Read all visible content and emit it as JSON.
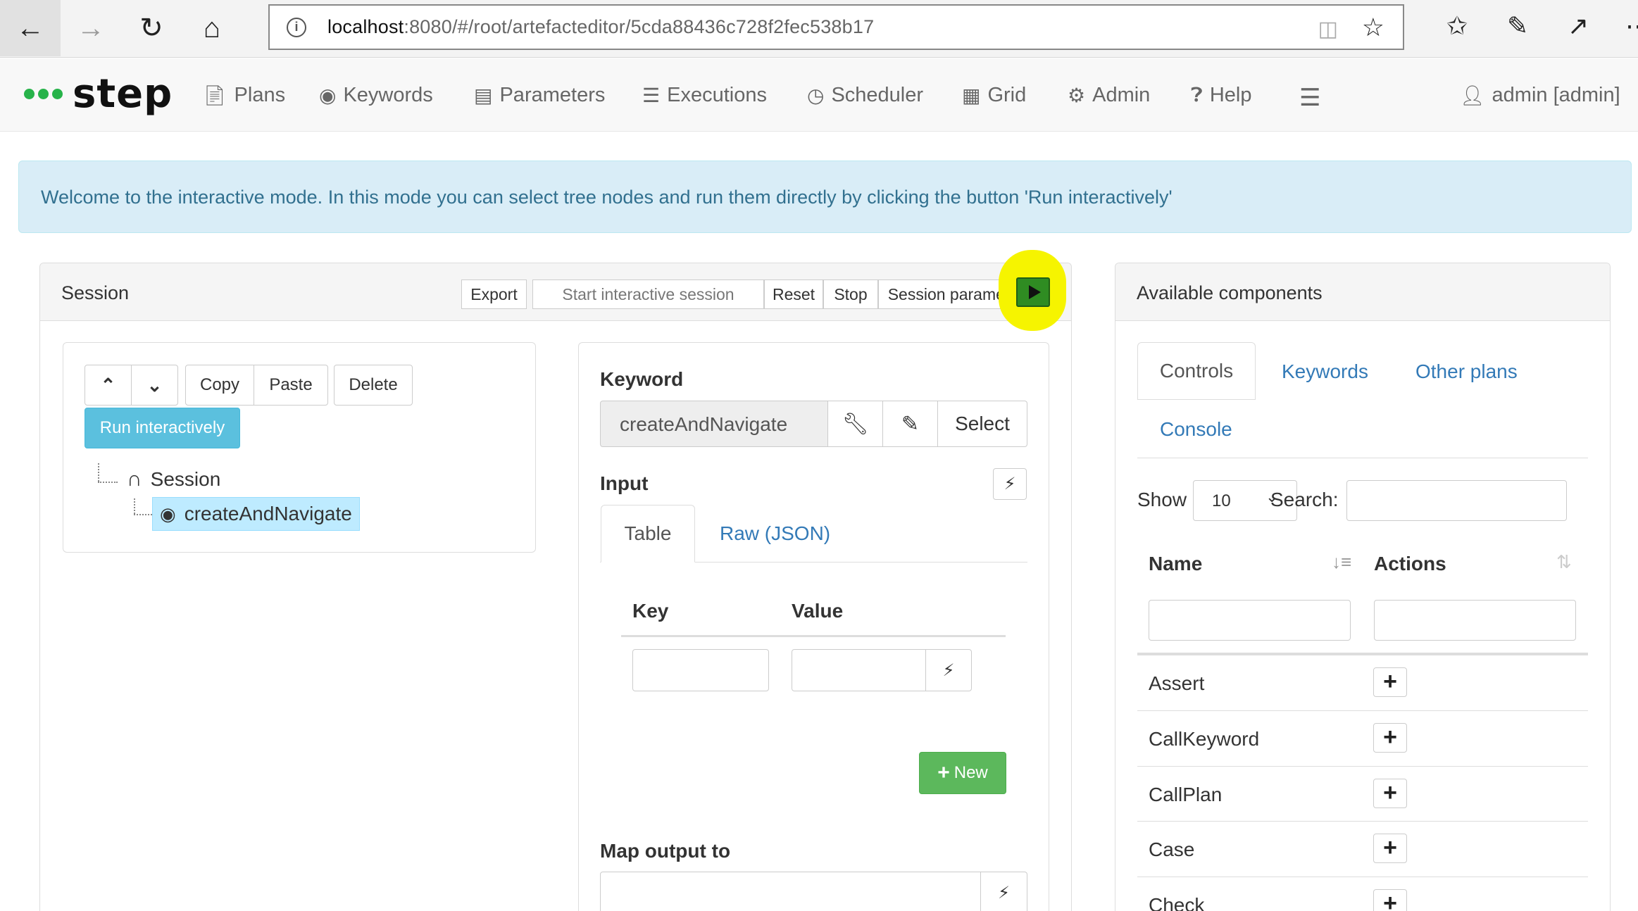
{
  "browser": {
    "url_host": "localhost",
    "url_rest": ":8080/#/root/artefacteditor/5cda88436c728f2fec538b17"
  },
  "app": {
    "brand": "step",
    "nav": [
      "Plans",
      "Keywords",
      "Parameters",
      "Executions",
      "Scheduler",
      "Grid",
      "Admin",
      "Help"
    ],
    "user": "admin [admin]"
  },
  "alert": "Welcome to the interactive mode. In this mode you can select tree nodes and run them directly by clicking the button 'Run interactively'",
  "session_panel": {
    "title": "Session",
    "buttons": [
      "Export",
      "Start interactive session",
      "Reset",
      "Stop",
      "Session parameters"
    ]
  },
  "tree": {
    "copy": "Copy",
    "paste": "Paste",
    "delete": "Delete",
    "run": "Run interactively",
    "root": "Session",
    "child": "createAndNavigate"
  },
  "editor": {
    "keyword_label": "Keyword",
    "keyword_value": "createAndNavigate",
    "select": "Select",
    "input_label": "Input",
    "tabs": [
      "Table",
      "Raw (JSON)"
    ],
    "col_key": "Key",
    "col_value": "Value",
    "new": "New",
    "map_output": "Map output to"
  },
  "components": {
    "title": "Available components",
    "tabs": [
      "Controls",
      "Keywords",
      "Other plans",
      "Console"
    ],
    "show": "Show",
    "page_size": "10",
    "search": "Search:",
    "col_name": "Name",
    "col_actions": "Actions",
    "rows": [
      "Assert",
      "CallKeyword",
      "CallPlan",
      "Case",
      "Check"
    ]
  }
}
